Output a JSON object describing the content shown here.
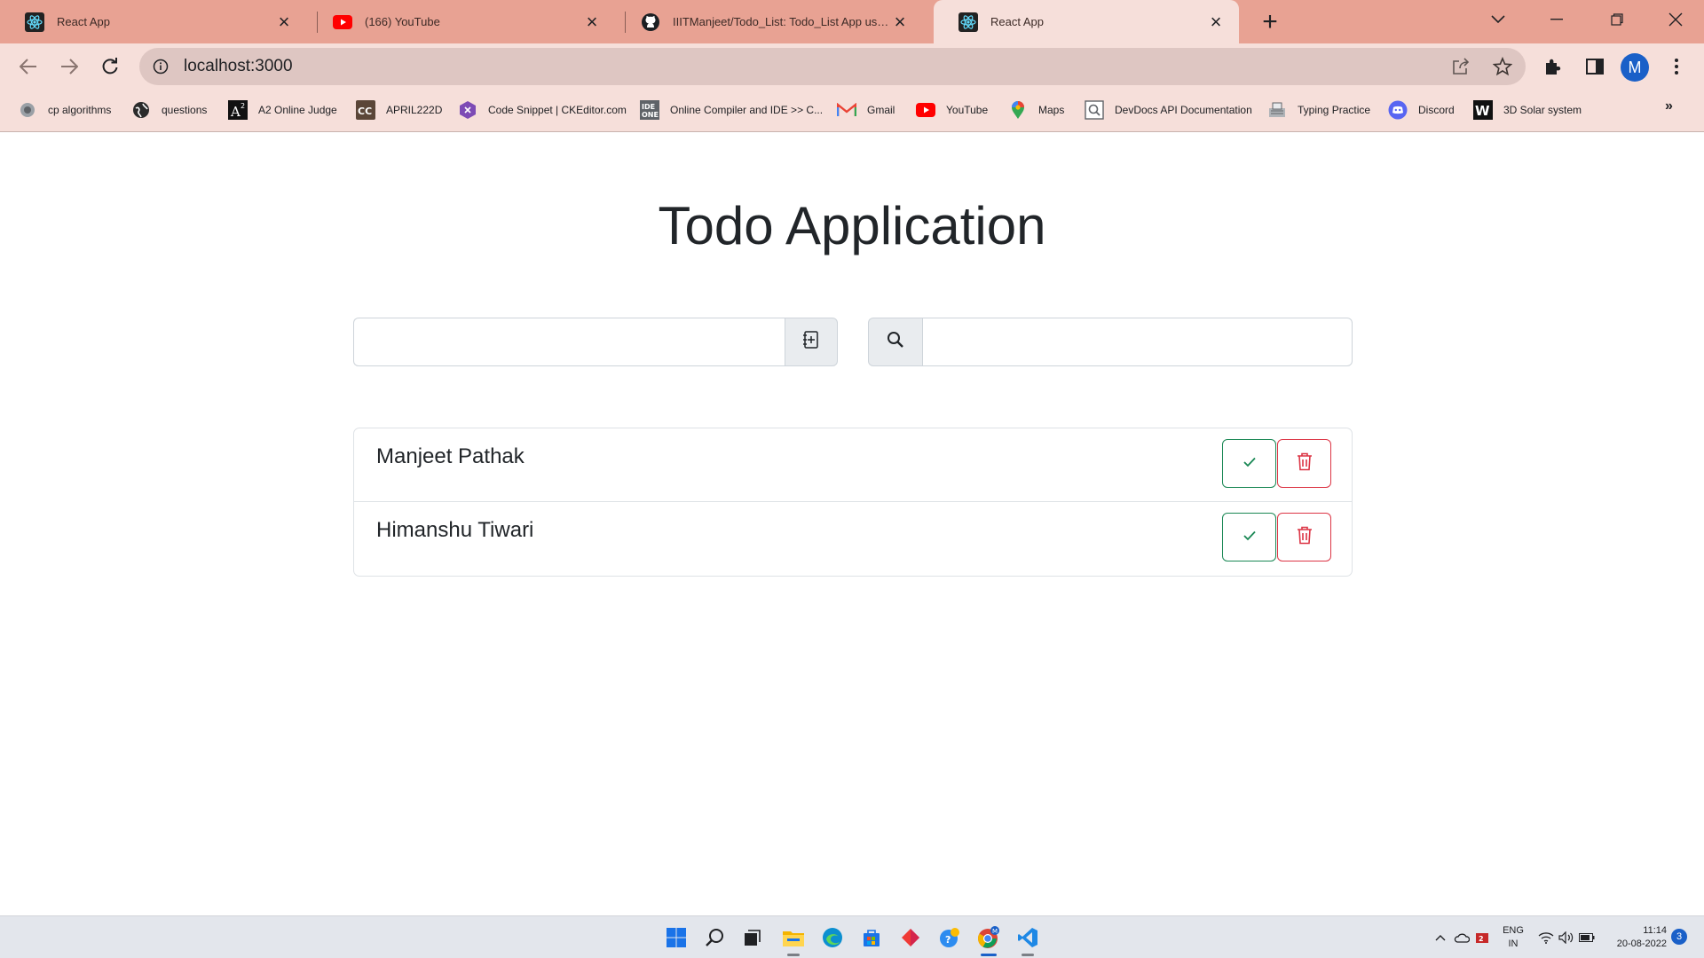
{
  "browser": {
    "tabs": [
      {
        "title": "React App",
        "icon": "react-icon",
        "active": false
      },
      {
        "title": "(166) YouTube",
        "icon": "youtube-icon",
        "active": false
      },
      {
        "title": "IIITManjeet/Todo_List: Todo_List App using React",
        "icon": "github-icon",
        "active": false
      },
      {
        "title": "React App",
        "icon": "react-icon",
        "active": true
      }
    ],
    "url": "localhost:3000",
    "avatar_initial": "M",
    "bookmarks": [
      {
        "label": "cp algorithms",
        "icon": "cp-algorithms-icon"
      },
      {
        "label": "questions",
        "icon": "globe-icon"
      },
      {
        "label": "A2 Online Judge",
        "icon": "a2-icon"
      },
      {
        "label": "APRIL222D",
        "icon": "codechef-icon"
      },
      {
        "label": "Code Snippet | CKEditor.com",
        "icon": "ckeditor-icon"
      },
      {
        "label": "Online Compiler and IDE >> C...",
        "icon": "ideone-icon"
      },
      {
        "label": "Gmail",
        "icon": "gmail-icon"
      },
      {
        "label": "YouTube",
        "icon": "youtube-icon"
      },
      {
        "label": "Maps",
        "icon": "maps-icon"
      },
      {
        "label": "DevDocs API Documentation",
        "icon": "devdocs-icon"
      },
      {
        "label": "Typing Practice",
        "icon": "typing-icon"
      },
      {
        "label": "Discord",
        "icon": "discord-icon"
      },
      {
        "label": "3D Solar system",
        "icon": "w-icon"
      }
    ]
  },
  "app": {
    "title": "Todo Application",
    "add_input_value": "",
    "search_input_value": "",
    "todos": [
      {
        "text": "Manjeet Pathak"
      },
      {
        "text": "Himanshu Tiwari"
      }
    ]
  },
  "taskbar": {
    "lang": [
      "ENG",
      "IN"
    ],
    "time": "11:14",
    "date": "20-08-2022",
    "notifications": "3"
  },
  "colors": {
    "tabstrip": "#e8a293",
    "toolbar": "#f6dfda",
    "success": "#198754",
    "danger": "#dc3545"
  }
}
